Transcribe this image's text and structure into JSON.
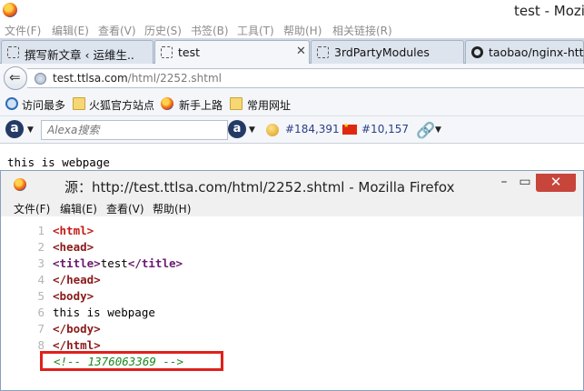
{
  "window": {
    "title": "test - Mozi"
  },
  "menu": [
    "文件(F)",
    "编辑(E)",
    "查看(V)",
    "历史(S)",
    "书签(B)",
    "工具(T)",
    "帮助(H)",
    "相关链接(R)"
  ],
  "tabs": [
    {
      "label": "撰写新文章 ‹ 运维生...",
      "icon": "page-icon",
      "active": false
    },
    {
      "label": "test",
      "icon": "page-icon",
      "active": true
    },
    {
      "label": "3rdPartyModules",
      "icon": "page-icon",
      "active": false
    },
    {
      "label": "taobao/nginx-http-",
      "icon": "github-icon",
      "active": false
    }
  ],
  "nav": {
    "url_host": "test.ttlsa.com",
    "url_path": "/html/2252.shtml"
  },
  "bookmarks": [
    "访问最多",
    "火狐官方站点",
    "新手上路",
    "常用网址"
  ],
  "alexa": {
    "search_placeholder": "Alexa搜索",
    "global_rank": "#184,391",
    "cn_rank": "#10,157"
  },
  "page": {
    "body_text": "this is webpage"
  },
  "source_window": {
    "title": "源：http://test.ttlsa.com/html/2252.shtml - Mozilla Firefox",
    "menu": [
      "文件(F)",
      "编辑(E)",
      "查看(V)",
      "帮助(H)"
    ],
    "lines": [
      {
        "num": "1",
        "open": "<",
        "tag": "html",
        "close": ">"
      },
      {
        "num": "2",
        "open": "<",
        "tag": "head",
        "close": ">"
      },
      {
        "num": "3",
        "open": "<",
        "tag": "title",
        "close": ">",
        "text": "test",
        "end_open": "</",
        "end_tag": "title",
        "end_close": ">"
      },
      {
        "num": "4",
        "open": "</",
        "tag": "head",
        "close": ">"
      },
      {
        "num": "5",
        "open": "<",
        "tag": "body",
        "close": ">"
      },
      {
        "num": "6",
        "text": "this is webpage"
      },
      {
        "num": "7",
        "open": "</",
        "tag": "body",
        "close": ">"
      },
      {
        "num": "8",
        "open": "</",
        "tag": "html",
        "close": ">"
      }
    ],
    "comment": "<!-- 1376063369 -->"
  },
  "colors": {
    "highlight_box": "#e0201b",
    "close_button": "#c7453b",
    "comment": "#1c8a1c"
  }
}
